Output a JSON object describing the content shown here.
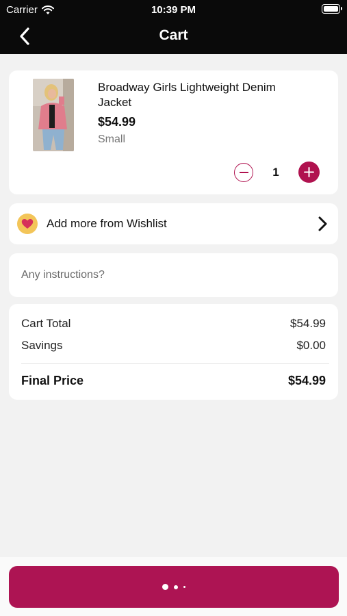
{
  "status_bar": {
    "carrier": "Carrier",
    "time": "10:39 PM"
  },
  "nav": {
    "title": "Cart",
    "back_icon": "chevron-left-icon"
  },
  "product": {
    "name": "Broadway Girls Lightweight Denim Jacket",
    "price": "$54.99",
    "size": "Small",
    "quantity": "1"
  },
  "wishlist": {
    "label": "Add more from Wishlist",
    "icon": "heart-icon"
  },
  "instructions": {
    "placeholder": "Any instructions?"
  },
  "totals": {
    "cart_total_label": "Cart Total",
    "cart_total_value": "$54.99",
    "savings_label": "Savings",
    "savings_value": "$0.00",
    "final_price_label": "Final Price",
    "final_price_value": "$54.99"
  },
  "colors": {
    "accent": "#ad1453",
    "header": "#0a0a0a",
    "background": "#f2f2f2",
    "wishlist_badge": "#f3c559"
  }
}
